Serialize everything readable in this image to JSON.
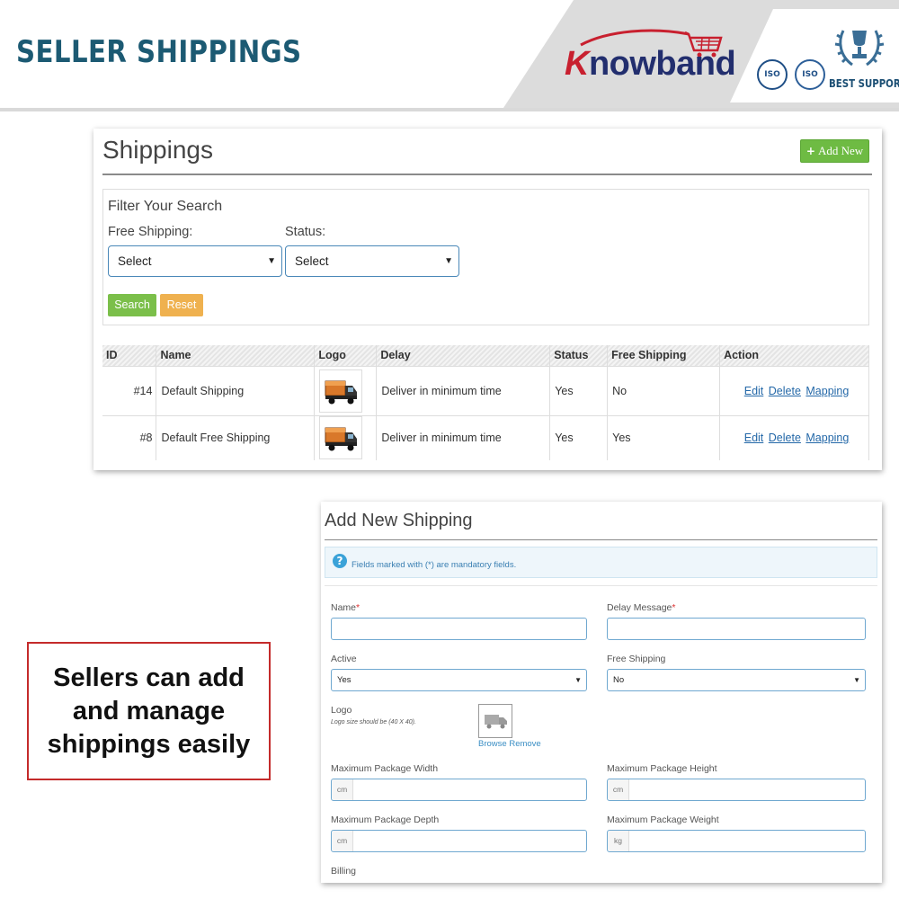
{
  "banner": {
    "title": "SELLER SHIPPINGS",
    "logo": {
      "k": "K",
      "rest": "nowband"
    },
    "cert_badges": [
      "ISO",
      "ISO"
    ],
    "best_support": "BEST SUPPORT",
    "colors": {
      "title": "#1c5a73",
      "logo_primary": "#222e6e",
      "logo_accent": "#c8202f"
    }
  },
  "shippings": {
    "title": "Shippings",
    "add_new_label": "Add New",
    "filter": {
      "title": "Filter Your Search",
      "free_shipping_label": "Free Shipping:",
      "free_shipping_value": "Select",
      "status_label": "Status:",
      "status_value": "Select",
      "search_label": "Search",
      "reset_label": "Reset"
    },
    "table": {
      "headers": [
        "ID",
        "Name",
        "Logo",
        "Delay",
        "Status",
        "Free Shipping",
        "Action"
      ],
      "rows": [
        {
          "id": "#14",
          "name": "Default Shipping",
          "logo_icon": "truck-icon",
          "delay": "Deliver in minimum time",
          "status": "Yes",
          "free_shipping": "No",
          "actions": [
            "Edit",
            "Delete",
            "Mapping"
          ]
        },
        {
          "id": "#8",
          "name": "Default Free Shipping",
          "logo_icon": "truck-icon",
          "delay": "Deliver in minimum time",
          "status": "Yes",
          "free_shipping": "Yes",
          "actions": [
            "Edit",
            "Delete",
            "Mapping"
          ]
        }
      ]
    }
  },
  "add_shipping": {
    "title": "Add New Shipping",
    "info_text": "Fields marked with (*) are mandatory fields.",
    "name_label": "Name",
    "delay_label": "Delay Message",
    "required_mark": "*",
    "active_label": "Active",
    "active_value": "Yes",
    "free_shipping_label": "Free Shipping",
    "free_shipping_value": "No",
    "logo_label": "Logo",
    "logo_hint": "Logo size should be (40 X 40).",
    "browse_label": "Browse",
    "remove_label": "Remove",
    "max_width_label": "Maximum Package Width",
    "max_height_label": "Maximum Package Height",
    "max_depth_label": "Maximum Package Depth",
    "max_weight_label": "Maximum Package Weight",
    "unit_cm": "cm",
    "unit_kg": "kg",
    "billing_label": "Billing"
  },
  "callout": {
    "lines": [
      "Sellers can add",
      "and manage",
      "shippings easily"
    ],
    "border_color": "#c42b2b"
  }
}
